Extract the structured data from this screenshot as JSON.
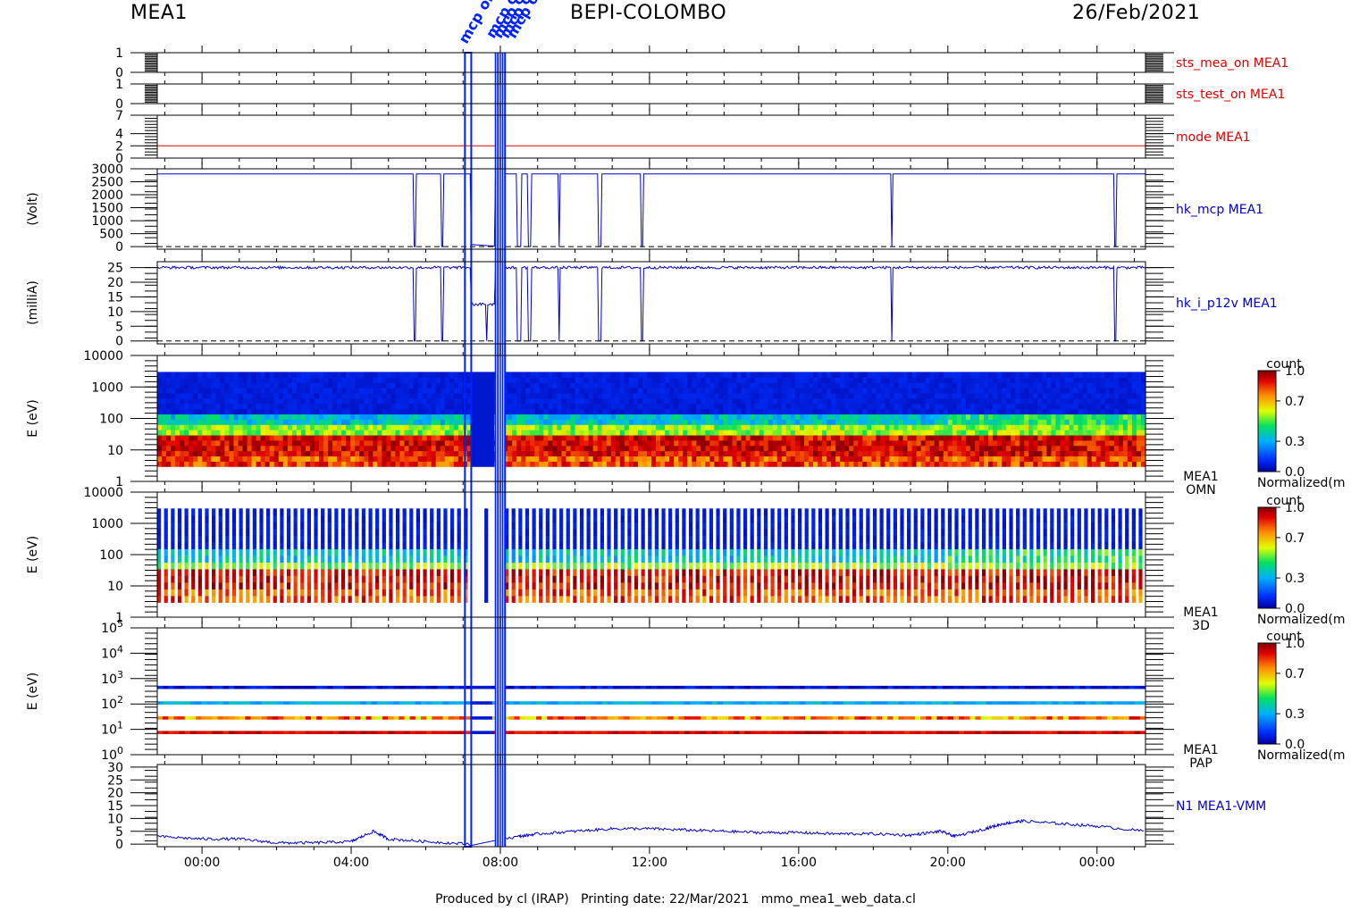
{
  "header": {
    "left": "MEA1",
    "center": "BEPI-COLOMBO",
    "right": "26/Feb/2021"
  },
  "top_annotation": "mcp on",
  "footer": {
    "producer": "Produced by cl (IRAP)",
    "printing": "Printing date: 22/Mar/2021",
    "file": "mmo_mea1_web_data.cl"
  },
  "colors": {
    "status_line": "#dd0000",
    "housekeeping_line": "#0000cc",
    "gap_bars": "#0022ff"
  },
  "chart_data": [
    {
      "type": "line",
      "panel": "sts_mea_on",
      "label": "sts_mea_on MEA1",
      "label_color": "#dd0000",
      "yticks": [
        "1",
        "0"
      ],
      "ylim": [
        0,
        1
      ],
      "value": 1
    },
    {
      "type": "line",
      "panel": "sts_test_on",
      "label": "sts_test_on MEA1",
      "label_color": "#dd0000",
      "yticks": [
        "1",
        "0"
      ],
      "ylim": [
        0,
        1
      ],
      "value": 0
    },
    {
      "type": "line",
      "panel": "mode",
      "label": "mode MEA1",
      "label_color": "#dd0000",
      "yticks": [
        "7",
        "4",
        "2",
        "0"
      ],
      "ylim": [
        0,
        7
      ],
      "value": 2
    },
    {
      "type": "line",
      "panel": "hk_mcp",
      "label": "hk_mcp MEA1",
      "label_color": "#0000cc",
      "ylabel": "(Volt)",
      "yticks": [
        "3000",
        "2500",
        "2000",
        "1500",
        "1000",
        "500",
        "0"
      ],
      "ylim": [
        -100,
        3000
      ],
      "baseline": 2800,
      "drops_to": 0,
      "drop_intervals_hours": [
        [
          5.68,
          5.72
        ],
        [
          6.42,
          6.47
        ],
        [
          8.45,
          8.55
        ],
        [
          8.73,
          8.82
        ],
        [
          9.55,
          9.6
        ],
        [
          10.62,
          10.7
        ],
        [
          11.78,
          11.83
        ],
        [
          18.47,
          18.52
        ],
        [
          24.45,
          24.52
        ]
      ]
    },
    {
      "type": "line",
      "panel": "hk_i_p12v",
      "label": "hk_i_p12v MEA1",
      "label_color": "#0000cc",
      "ylabel": "(milliA)",
      "yticks": [
        "25",
        "20",
        "15",
        "10",
        "5",
        "0"
      ],
      "ylim": [
        -1,
        27
      ],
      "baseline": 25,
      "drops_to": 0,
      "drop_intervals_hours": [
        [
          5.68,
          5.72
        ],
        [
          6.42,
          6.47
        ],
        [
          8.45,
          8.55
        ],
        [
          8.73,
          8.82
        ],
        [
          9.55,
          9.6
        ],
        [
          10.62,
          10.7
        ],
        [
          11.78,
          11.83
        ],
        [
          18.47,
          18.52
        ],
        [
          24.45,
          24.52
        ]
      ]
    },
    {
      "type": "heatmap",
      "panel": "OMN",
      "label": "MEA1\nOMN",
      "ylabel": "E (eV)",
      "yscale": "log",
      "yticks": [
        "10000",
        "1000",
        "100",
        "10",
        "1"
      ],
      "ylim": [
        1,
        10000
      ],
      "colorbar": {
        "title": "count",
        "ticks": [
          "1.0",
          "0.7",
          "0.3",
          "0.0"
        ],
        "caption": "Normalized(m"
      }
    },
    {
      "type": "heatmap",
      "panel": "3D",
      "label": "MEA1\n3D",
      "ylabel": "E (eV)",
      "yscale": "log",
      "yticks": [
        "10000",
        "1000",
        "100",
        "10",
        "1"
      ],
      "ylim": [
        1,
        10000
      ],
      "colorbar": {
        "title": "count",
        "ticks": [
          "1.0",
          "0.7",
          "0.3",
          "0.0"
        ],
        "caption": "Normalized(m"
      }
    },
    {
      "type": "heatmap",
      "panel": "PAP",
      "label": "MEA1\nPAP",
      "ylabel": "E (eV)",
      "yscale": "log",
      "yticks": [
        "5",
        "4",
        "3",
        "2",
        "1",
        "0"
      ],
      "ytick_base": "10",
      "ylim": [
        1,
        100000
      ],
      "energy_lines_eV": [
        450,
        110,
        28,
        7.5
      ],
      "colorbar": {
        "title": "count",
        "ticks": [
          "1.0",
          "0.7",
          "0.3",
          "0.0"
        ],
        "caption": "Normalized(m"
      }
    },
    {
      "type": "line",
      "panel": "N1_VMM",
      "label": "N1 MEA1-VMM",
      "label_color": "#0000cc",
      "yticks": [
        "30",
        "25",
        "20",
        "15",
        "10",
        "5",
        "0"
      ],
      "ylim": [
        -1,
        31
      ],
      "x": [
        -1.2,
        0,
        1,
        2,
        3,
        4,
        4.6,
        5,
        6,
        7.2,
        8.5,
        9,
        10,
        11,
        12,
        13,
        14,
        15,
        16,
        17,
        18,
        19,
        19.8,
        20.2,
        21,
        21.5,
        22,
        23,
        24,
        25.3
      ],
      "y": [
        3,
        2,
        2,
        0.5,
        0.5,
        1,
        5,
        2,
        1,
        0,
        3,
        4,
        5,
        6,
        6,
        5.5,
        5,
        4.5,
        4.5,
        4,
        4,
        3.5,
        5,
        3,
        6,
        8,
        9,
        8,
        7,
        5
      ]
    }
  ],
  "xaxis": {
    "ticks": [
      "00:00",
      "04:00",
      "08:00",
      "12:00",
      "16:00",
      "20:00",
      "00:00"
    ],
    "tick_hours": [
      0,
      4,
      8,
      12,
      16,
      20,
      24
    ],
    "range_hours": [
      -1.2,
      25.3
    ]
  }
}
